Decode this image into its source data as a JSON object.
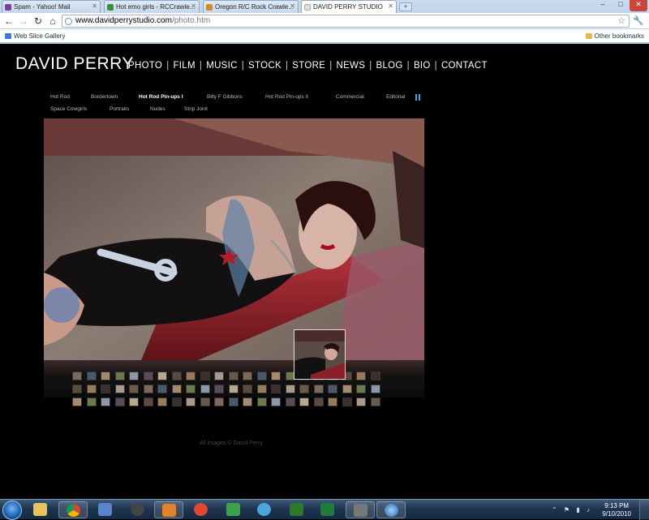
{
  "browser": {
    "tabs": [
      {
        "label": "Spam - Yahoo! Mail",
        "color": "#7b3fa0",
        "active": false
      },
      {
        "label": "Hot emo girls - RCCrawle...",
        "color": "#3b8f3b",
        "active": false
      },
      {
        "label": "Oregon R/C Rock Crawle...",
        "color": "#d08a2a",
        "active": false
      },
      {
        "label": "DAVID PERRY STUDIO",
        "color": "#ffffff",
        "active": true
      }
    ],
    "url_host": "www.davidperrystudio.com",
    "url_path": "/photo.htm",
    "bookmark_left": "Web Slice Gallery",
    "bookmark_right": "Other bookmarks",
    "window_controls": [
      "–",
      "□",
      "✕"
    ]
  },
  "site": {
    "brand": "DAVID PERRY",
    "nav": [
      "PHOTO",
      "FILM",
      "MUSIC",
      "STOCK",
      "STORE",
      "NEWS",
      "BLOG",
      "BIO",
      "CONTACT"
    ],
    "categories_row1": [
      "Hot Rod",
      "Bordertown",
      "Hot Rod Pin-ups I",
      "Billy F Gibbons",
      "Hot Rod Pin-ups II",
      "Commercial",
      "Editorial"
    ],
    "categories_row2": [
      "Space Cowgirls",
      "Portraits",
      "Nudes",
      "Strip Joint"
    ],
    "active_category": "Hot Rod Pin-ups I",
    "copyright": "All images © David Perry"
  },
  "taskbar": {
    "time": "9:13 PM",
    "date": "9/10/2010",
    "apps": [
      "ie",
      "explorer",
      "chrome",
      "network",
      "security",
      "media-player",
      "slingbox",
      "utorrent",
      "messenger",
      "remote-desktop",
      "excel",
      "photos",
      "ie-alt"
    ]
  }
}
